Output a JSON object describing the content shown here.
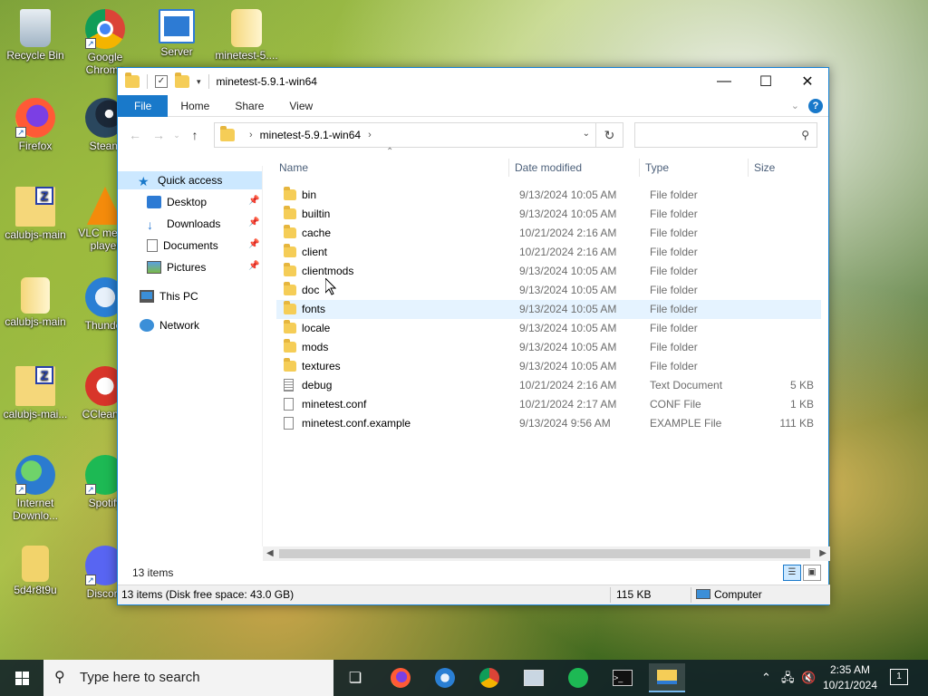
{
  "desktop": {
    "icons": [
      {
        "label": "Recycle Bin",
        "icon": "recycle-bin-icon"
      },
      {
        "label": "Google Chrome",
        "icon": "chrome-icon"
      },
      {
        "label": "Server",
        "icon": "server-icon"
      },
      {
        "label": "minetest-5....",
        "icon": "folder-zip-icon"
      },
      {
        "label": "Firefox",
        "icon": "firefox-icon"
      },
      {
        "label": "Steam",
        "icon": "steam-icon"
      },
      {
        "label": "calubjs-main",
        "icon": "zip-archive-icon"
      },
      {
        "label": "VLC media player",
        "icon": "vlc-icon"
      },
      {
        "label": "calubjs-main",
        "icon": "folder-icon"
      },
      {
        "label": "Thunder",
        "icon": "thunderbird-icon"
      },
      {
        "label": "calubjs-mai...",
        "icon": "zip-archive-icon"
      },
      {
        "label": "CCleaner",
        "icon": "ccleaner-icon"
      },
      {
        "label": "Internet Downlo...",
        "icon": "idm-icon"
      },
      {
        "label": "Spotify",
        "icon": "spotify-icon"
      },
      {
        "label": "5d4r8t9u",
        "icon": "file-icon"
      },
      {
        "label": "Discord",
        "icon": "discord-icon"
      }
    ]
  },
  "window": {
    "title": "minetest-5.9.1-win64",
    "ribbon_tabs": [
      "File",
      "Home",
      "Share",
      "View"
    ],
    "address": {
      "crumb": "minetest-5.9.1-win64"
    },
    "search": {
      "placeholder": ""
    },
    "nav": {
      "quick_access": "Quick access",
      "items": [
        "Desktop",
        "Downloads",
        "Documents",
        "Pictures"
      ],
      "this_pc": "This PC",
      "network": "Network"
    },
    "columns": {
      "name": "Name",
      "date": "Date modified",
      "type": "Type",
      "size": "Size"
    },
    "files": [
      {
        "name": "bin",
        "date": "9/13/2024 10:05 AM",
        "type": "File folder",
        "size": "",
        "kind": "folder"
      },
      {
        "name": "builtin",
        "date": "9/13/2024 10:05 AM",
        "type": "File folder",
        "size": "",
        "kind": "folder"
      },
      {
        "name": "cache",
        "date": "10/21/2024 2:16 AM",
        "type": "File folder",
        "size": "",
        "kind": "folder"
      },
      {
        "name": "client",
        "date": "10/21/2024 2:16 AM",
        "type": "File folder",
        "size": "",
        "kind": "folder"
      },
      {
        "name": "clientmods",
        "date": "9/13/2024 10:05 AM",
        "type": "File folder",
        "size": "",
        "kind": "folder"
      },
      {
        "name": "doc",
        "date": "9/13/2024 10:05 AM",
        "type": "File folder",
        "size": "",
        "kind": "folder"
      },
      {
        "name": "fonts",
        "date": "9/13/2024 10:05 AM",
        "type": "File folder",
        "size": "",
        "kind": "folder"
      },
      {
        "name": "locale",
        "date": "9/13/2024 10:05 AM",
        "type": "File folder",
        "size": "",
        "kind": "folder"
      },
      {
        "name": "mods",
        "date": "9/13/2024 10:05 AM",
        "type": "File folder",
        "size": "",
        "kind": "folder"
      },
      {
        "name": "textures",
        "date": "9/13/2024 10:05 AM",
        "type": "File folder",
        "size": "",
        "kind": "folder"
      },
      {
        "name": "debug",
        "date": "10/21/2024 2:16 AM",
        "type": "Text Document",
        "size": "5 KB",
        "kind": "text"
      },
      {
        "name": "minetest.conf",
        "date": "10/21/2024 2:17 AM",
        "type": "CONF File",
        "size": "1 KB",
        "kind": "file"
      },
      {
        "name": "minetest.conf.example",
        "date": "9/13/2024 9:56 AM",
        "type": "EXAMPLE File",
        "size": "111 KB",
        "kind": "file"
      }
    ],
    "items_count": "13 items",
    "status": {
      "left": "13 items (Disk free space: 43.0 GB)",
      "size": "115 KB",
      "location": "Computer"
    }
  },
  "taskbar": {
    "search_placeholder": "Type here to search",
    "time": "2:35 AM",
    "date": "10/21/2024",
    "notifications": "1"
  }
}
